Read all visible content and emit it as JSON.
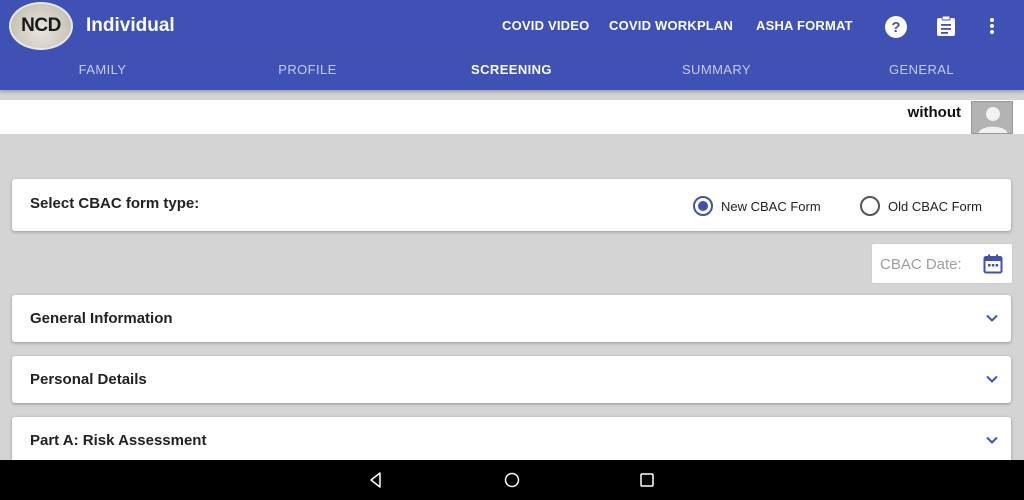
{
  "app": {
    "logo_text": "NCD",
    "title": "Individual",
    "actions": [
      "COVID VIDEO",
      "COVID WORKPLAN",
      "ASHA FORMAT"
    ],
    "help_icon": "help-circle-icon",
    "clipboard_icon": "clipboard-icon",
    "more_icon": "more-vert-icon",
    "primary_color": "#3f51b5"
  },
  "tabs": [
    {
      "label": "FAMILY",
      "active": false
    },
    {
      "label": "PROFILE",
      "active": false
    },
    {
      "label": "SCREENING",
      "active": true
    },
    {
      "label": "SUMMARY",
      "active": false
    },
    {
      "label": "GENERAL",
      "active": false
    }
  ],
  "user": {
    "name": "without",
    "avatar_icon": "person-placeholder-icon"
  },
  "form_type": {
    "label": "Select CBAC form type:",
    "options": [
      {
        "label": "New CBAC Form",
        "checked": true
      },
      {
        "label": "Old CBAC Form",
        "checked": false
      }
    ]
  },
  "cbac_date": {
    "placeholder": "CBAC Date:",
    "icon": "calendar-icon"
  },
  "sections": [
    {
      "title": "General Information",
      "icon": "chevron-down-icon"
    },
    {
      "title": "Personal Details",
      "icon": "chevron-down-icon"
    },
    {
      "title": "Part A: Risk Assessment",
      "icon": "chevron-down-icon"
    }
  ],
  "system_nav": [
    "back-icon",
    "home-icon",
    "recents-icon"
  ]
}
